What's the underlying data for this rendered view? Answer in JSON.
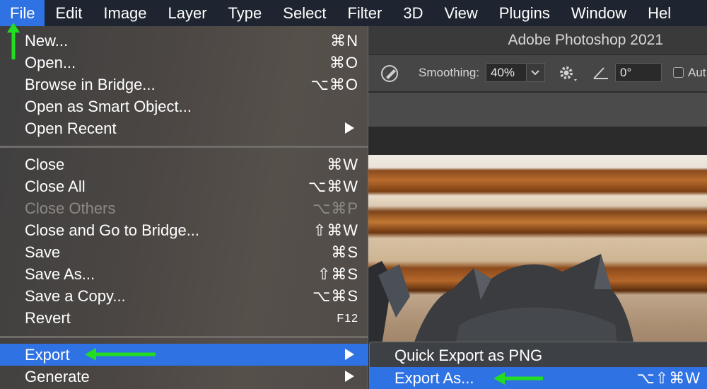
{
  "menubar": {
    "items": [
      "File",
      "Edit",
      "Image",
      "Layer",
      "Type",
      "Select",
      "Filter",
      "3D",
      "View",
      "Plugins",
      "Window",
      "Hel"
    ]
  },
  "window": {
    "title": "Adobe Photoshop 2021"
  },
  "options": {
    "smoothing_label": "Smoothing:",
    "smoothing_value": "40%",
    "angle_value": "0°",
    "checkbox_label": "Aut"
  },
  "file_menu": {
    "items": [
      {
        "label": "New...",
        "shortcut": "⌘N"
      },
      {
        "label": "Open...",
        "shortcut": "⌘O"
      },
      {
        "label": "Browse in Bridge...",
        "shortcut": "⌥⌘O"
      },
      {
        "label": "Open as Smart Object...",
        "shortcut": ""
      },
      {
        "label": "Open Recent",
        "shortcut": ""
      },
      {
        "label": "Close",
        "shortcut": "⌘W"
      },
      {
        "label": "Close All",
        "shortcut": "⌥⌘W"
      },
      {
        "label": "Close Others",
        "shortcut": "⌥⌘P"
      },
      {
        "label": "Close and Go to Bridge...",
        "shortcut": "⇧⌘W"
      },
      {
        "label": "Save",
        "shortcut": "⌘S"
      },
      {
        "label": "Save As...",
        "shortcut": "⇧⌘S"
      },
      {
        "label": "Save a Copy...",
        "shortcut": "⌥⌘S"
      },
      {
        "label": "Revert",
        "shortcut": "F12"
      },
      {
        "label": "Export",
        "shortcut": ""
      },
      {
        "label": "Generate",
        "shortcut": ""
      }
    ]
  },
  "export_submenu": {
    "items": [
      {
        "label": "Quick Export as PNG",
        "shortcut": ""
      },
      {
        "label": "Export As...",
        "shortcut": "⌥⇧⌘W"
      }
    ]
  },
  "colors": {
    "highlight": "#2f72e3",
    "annotation_arrow": "#22dd22",
    "menubar_bg": "#1f2530"
  },
  "icons": [
    "brush-pressure-icon",
    "gear-icon",
    "angle-icon",
    "submenu-arrow-icon"
  ]
}
